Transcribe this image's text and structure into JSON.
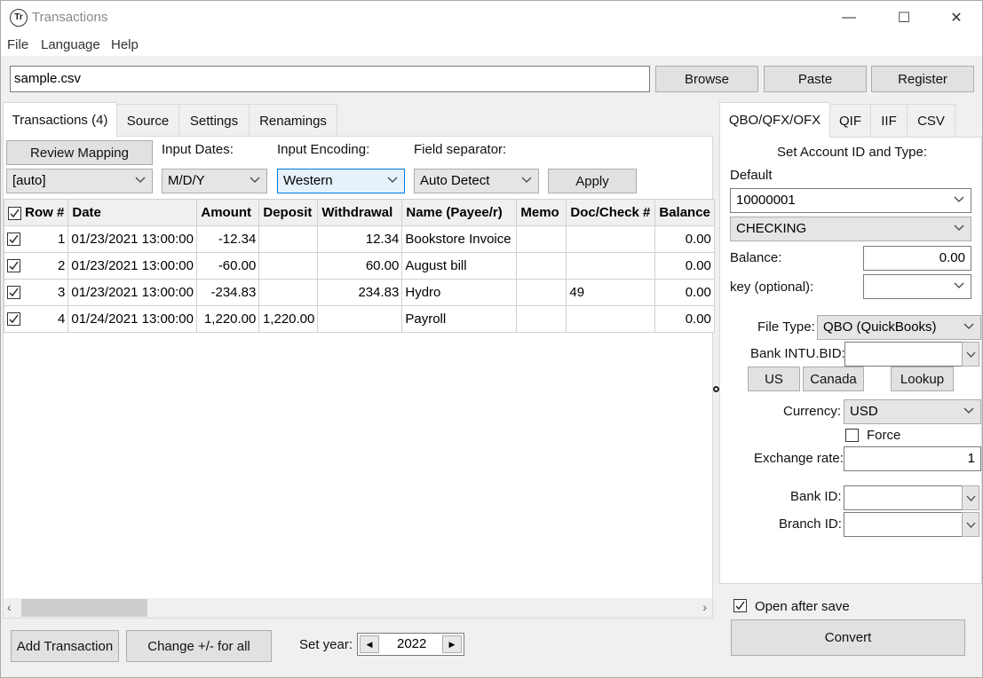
{
  "window": {
    "title": "Transactions",
    "app_icon_text": "Tr",
    "controls": {
      "minimize": "—",
      "maximize": "☐",
      "close": "✕"
    }
  },
  "menu": [
    "File",
    "Language",
    "Help"
  ],
  "toolbar": {
    "file_path": "sample.csv",
    "browse_label": "Browse",
    "paste_label": "Paste",
    "register_label": "Register"
  },
  "left_tabs": [
    {
      "label": "Transactions (4)",
      "active": true
    },
    {
      "label": "Source",
      "active": false
    },
    {
      "label": "Settings",
      "active": false
    },
    {
      "label": "Renamings",
      "active": false
    }
  ],
  "controls": {
    "review_mapping_label": "Review Mapping",
    "mapping_value": "[auto]",
    "input_dates_label": "Input Dates:",
    "input_dates_value": "M/D/Y",
    "input_encoding_label": "Input Encoding:",
    "input_encoding_value": "Western",
    "field_separator_label": "Field separator:",
    "field_separator_value": "Auto Detect",
    "apply_label": "Apply"
  },
  "table": {
    "all_checked": true,
    "columns": [
      "Row #",
      "Date",
      "Amount",
      "Deposit",
      "Withdrawal",
      "Name (Payee/r)",
      "Memo",
      "Doc/Check #",
      "Balance"
    ],
    "rows": [
      {
        "checked": true,
        "row": "1",
        "date": "01/23/2021 13:00:00",
        "amount": "-12.34",
        "deposit": "",
        "withdrawal": "12.34",
        "name": "Bookstore Invoice",
        "memo": "",
        "doc": "",
        "balance": "0.00"
      },
      {
        "checked": true,
        "row": "2",
        "date": "01/23/2021 13:00:00",
        "amount": "-60.00",
        "deposit": "",
        "withdrawal": "60.00",
        "name": "August bill",
        "memo": "",
        "doc": "",
        "balance": "0.00"
      },
      {
        "checked": true,
        "row": "3",
        "date": "01/23/2021 13:00:00",
        "amount": "-234.83",
        "deposit": "",
        "withdrawal": "234.83",
        "name": "Hydro",
        "memo": "",
        "doc": "49",
        "balance": "0.00"
      },
      {
        "checked": true,
        "row": "4",
        "date": "01/24/2021 13:00:00",
        "amount": "1,220.00",
        "deposit": "1,220.00",
        "withdrawal": "",
        "name": "Payroll",
        "memo": "",
        "doc": "",
        "balance": "0.00"
      }
    ]
  },
  "bottom": {
    "add_transaction_label": "Add Transaction",
    "change_sign_label": "Change +/- for all",
    "set_year_label": "Set year:",
    "year_value": "2022"
  },
  "right_tabs": [
    {
      "label": "QBO/QFX/OFX",
      "active": true
    },
    {
      "label": "QIF",
      "active": false
    },
    {
      "label": "IIF",
      "active": false
    },
    {
      "label": "CSV",
      "active": false
    }
  ],
  "account": {
    "heading": "Set Account ID and Type:",
    "default_label": "Default",
    "account_id": "10000001",
    "account_type": "CHECKING",
    "balance_label": "Balance:",
    "balance_value": "0.00",
    "key_label": "key (optional):",
    "key_value": "",
    "file_type_label": "File Type:",
    "file_type_value": "QBO (QuickBooks)",
    "bank_intu_label": "Bank INTU.BID:",
    "bank_intu_value": "",
    "us_label": "US",
    "canada_label": "Canada",
    "lookup_label": "Lookup",
    "currency_label": "Currency:",
    "currency_value": "USD",
    "force_label": "Force",
    "force_checked": false,
    "exchange_rate_label": "Exchange rate:",
    "exchange_rate_value": "1",
    "bank_id_label": "Bank ID:",
    "bank_id_value": "",
    "branch_id_label": "Branch ID:",
    "branch_id_value": ""
  },
  "footer": {
    "open_after_save_label": "Open after save",
    "open_after_save_checked": true,
    "convert_label": "Convert"
  }
}
